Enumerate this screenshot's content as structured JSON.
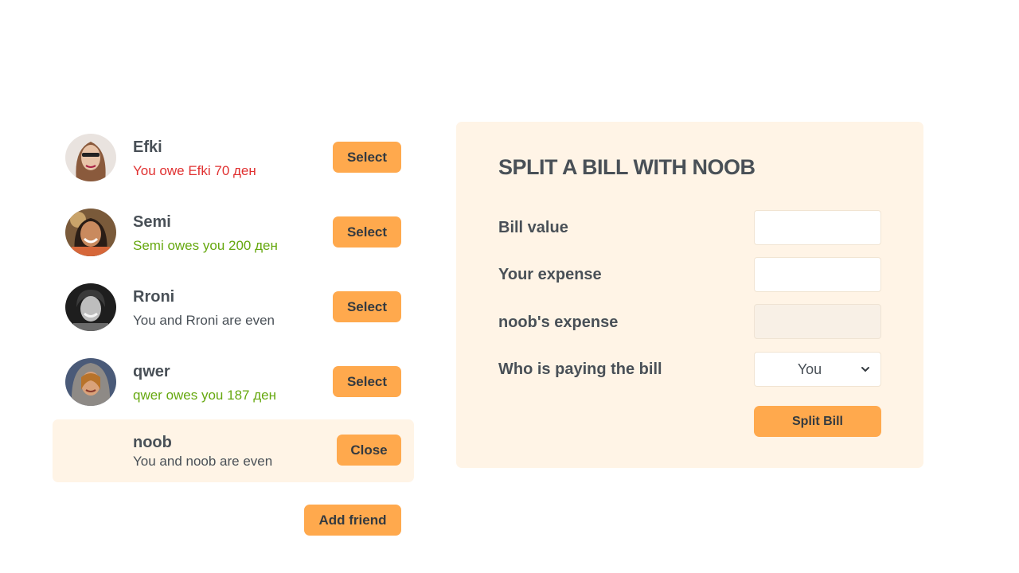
{
  "friends": [
    {
      "name": "Efki",
      "status": "You owe Efki 70 ден",
      "status_type": "red",
      "button": "Select"
    },
    {
      "name": "Semi",
      "status": "Semi owes you 200 ден",
      "status_type": "green",
      "button": "Select"
    },
    {
      "name": "Rroni",
      "status": "You and Rroni are even",
      "status_type": "even",
      "button": "Select"
    },
    {
      "name": "qwer",
      "status": "qwer owes you 187 ден",
      "status_type": "green",
      "button": "Select"
    },
    {
      "name": "noob",
      "status": "You and noob are even",
      "status_type": "even",
      "button": "Close"
    }
  ],
  "add_friend_label": "Add friend",
  "form": {
    "title": "SPLIT A BILL WITH NOOB",
    "bill_value_label": "Bill value",
    "bill_value": "",
    "your_expense_label": "Your expense",
    "your_expense": "",
    "friend_expense_label": "noob's expense",
    "friend_expense": "",
    "payer_label": "Who is paying the bill",
    "payer_value": "You",
    "submit_label": "Split Bill"
  },
  "colors": {
    "accent": "#ffa94d",
    "panel": "#fff4e6",
    "owe": "#e03131",
    "owed": "#66a80f",
    "text": "#495057"
  }
}
